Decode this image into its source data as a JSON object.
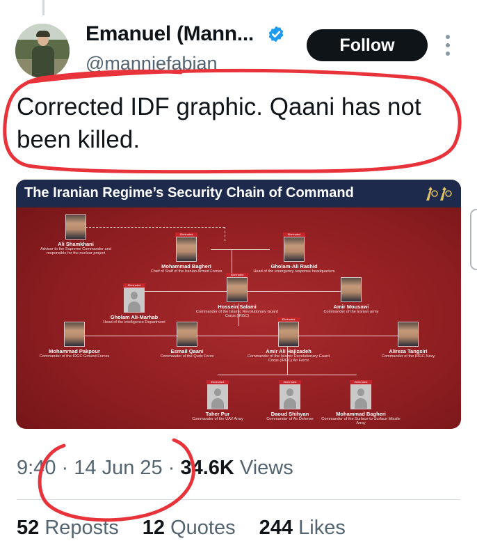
{
  "author": {
    "name": "Emanuel (Mann...",
    "handle": "@manniefabian",
    "follow_label": "Follow"
  },
  "tweet": {
    "text": "Corrected IDF graphic. Qaani has not been killed."
  },
  "graphic": {
    "title": "The Iranian Regime’s Security Chain of Command",
    "eliminated_label": "Eliminated",
    "people": [
      {
        "name": "Ali Shamkhani",
        "role": "Advisor to the Supreme Commander and responsible for the nuclear project",
        "eliminated": false
      },
      {
        "name": "Mohammad Bagheri",
        "role": "Chief of Staff of the Iranian Armed Forces",
        "eliminated": true
      },
      {
        "name": "Gholam-Ali Rashid",
        "role": "Head of the emergency response headquarters",
        "eliminated": true
      },
      {
        "name": "Hossein Salami",
        "role": "Commander of the Islamic Revolutionary Guard Corps (IRGC)",
        "eliminated": true
      },
      {
        "name": "Gholam Ali-Marhab",
        "role": "Head of the intelligence Department",
        "eliminated": true
      },
      {
        "name": "Amir Mousawi",
        "role": "Commander of the Iranian army",
        "eliminated": false
      },
      {
        "name": "Mohammad Pakpour",
        "role": "Commander of the IRGC Ground Forces",
        "eliminated": false
      },
      {
        "name": "Esmail Qaani",
        "role": "Commander of the Quds Force",
        "eliminated": false
      },
      {
        "name": "Amir Ali Hajizadeh",
        "role": "Commander of the Islamic Revolutionary Guard Corps (IRGC) Air Force",
        "eliminated": true
      },
      {
        "name": "Alireza Tangsiri",
        "role": "Commander of the IRGC Navy",
        "eliminated": false
      },
      {
        "name": "Taher Pur",
        "role": "Commander of the UAV Array",
        "eliminated": true
      },
      {
        "name": "Daoud Shihyan",
        "role": "Commander of Air Defense",
        "eliminated": true
      },
      {
        "name": "Mohammad Bagheri",
        "role": "Commander of the Surface-to-Surface Missile Array",
        "eliminated": true
      }
    ]
  },
  "meta": {
    "time": "9:40",
    "sep1": "·",
    "date": "14 Jun 25",
    "sep2": "·",
    "views_count": "34.6K",
    "views_label": "Views"
  },
  "stats": {
    "reposts_count": "52",
    "reposts_label": "Reposts",
    "quotes_count": "12",
    "quotes_label": "Quotes",
    "likes_count": "244",
    "likes_label": "Likes"
  },
  "colors": {
    "annotation": "#e8333b",
    "follow_bg": "#0f1419",
    "verified": "#1d9bf0",
    "graphic_bg": "#8c1d20",
    "graphic_header": "#1d2a4c"
  },
  "icons": [
    "verified-badge-icon",
    "more-options-icon",
    "idf-emblem-icon"
  ]
}
